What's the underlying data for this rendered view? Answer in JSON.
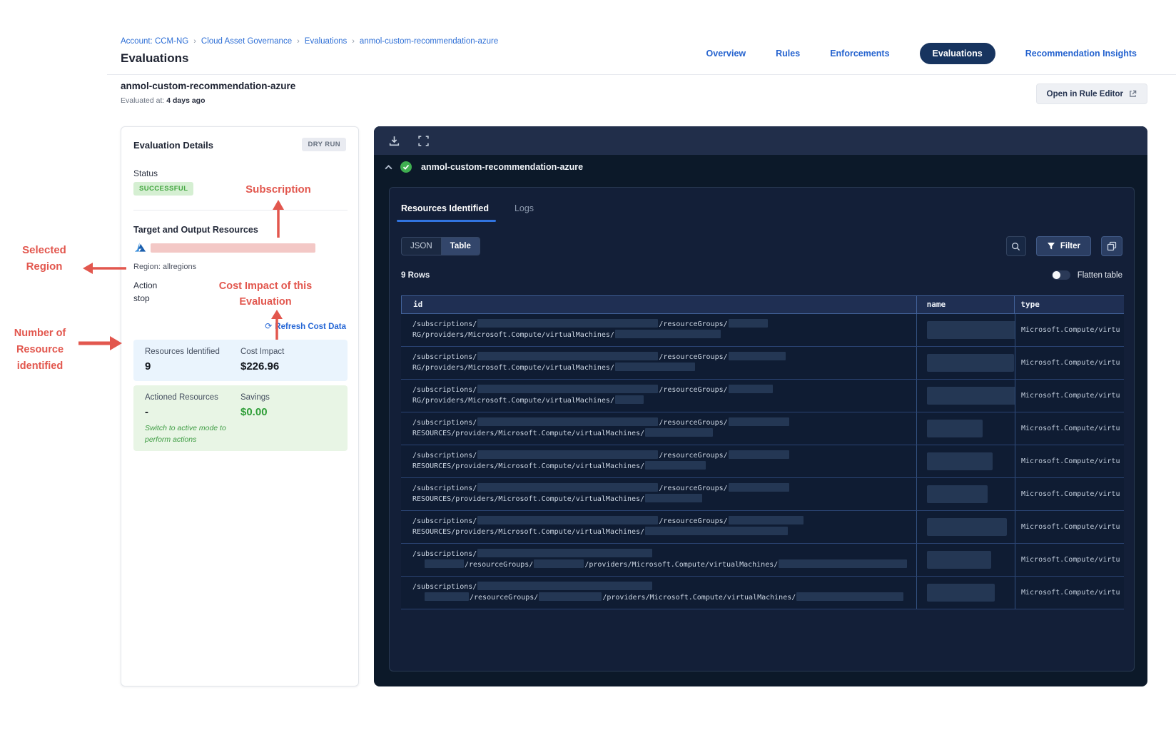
{
  "breadcrumb": {
    "separator": "›",
    "items": [
      "Account: CCM-NG",
      "Cloud Asset Governance",
      "Evaluations",
      "anmol-custom-recommendation-azure"
    ]
  },
  "page_title": "Evaluations",
  "nav": {
    "tabs": [
      "Overview",
      "Rules",
      "Enforcements",
      "Evaluations",
      "Recommendation Insights"
    ],
    "active": "Evaluations"
  },
  "header": {
    "name": "anmol-custom-recommendation-azure",
    "evaluated_label": "Evaluated at:",
    "evaluated_value": "4 days ago",
    "open_rule_editor": "Open in Rule Editor"
  },
  "details": {
    "title": "Evaluation Details",
    "mode_badge": "DRY RUN",
    "status_label": "Status",
    "status_value": "SUCCESSFUL",
    "target_title": "Target and Output Resources",
    "region_label": "Region:",
    "region_value": "allregions",
    "action_label": "Action",
    "action_value": "stop",
    "refresh_icon": "⟳",
    "refresh_link": "Refresh Cost Data",
    "resources_identified_label": "Resources Identified",
    "resources_identified_value": "9",
    "cost_impact_label": "Cost Impact",
    "cost_impact_value": "$226.96",
    "actioned_label": "Actioned Resources",
    "actioned_value": "-",
    "savings_label": "Savings",
    "savings_value": "$0.00",
    "note_line1": "Switch to active mode to",
    "note_line2": "perform actions"
  },
  "annotations": {
    "color": "#e2574e",
    "subscription": "Subscription",
    "selected_region_line1": "Selected",
    "selected_region_line2": "Region",
    "cost_impact_line1": "Cost Impact of this",
    "cost_impact_line2": "Evaluation",
    "resources_line1": "Number of",
    "resources_line2": "Resource",
    "resources_line3": "identified"
  },
  "viewer": {
    "title": "anmol-custom-recommendation-azure",
    "tabs": [
      "Resources Identified",
      "Logs"
    ],
    "active_tab": "Resources Identified",
    "view_toggle": [
      "JSON",
      "Table"
    ],
    "active_view": "Table",
    "filter_label": "Filter",
    "rows_count": "9 Rows",
    "flatten_label": "Flatten table",
    "table": {
      "columns": [
        "id",
        "name",
        "type"
      ],
      "rows": [
        {
          "line1": [
            {
              "t": "/subscriptions/"
            },
            {
              "r": 253
            },
            {
              "t": "/resourceGroups/"
            },
            {
              "r": 55
            }
          ],
          "line2": [
            {
              "t": "RG/providers/Microsoft.Compute/virtualMachines/"
            },
            {
              "r": 148
            }
          ],
          "name_r": 125,
          "type": "Microsoft.Compute/virtu"
        },
        {
          "line1": [
            {
              "t": "/subscriptions/"
            },
            {
              "r": 253
            },
            {
              "t": "/resourceGroups/"
            },
            {
              "r": 80
            }
          ],
          "line2": [
            {
              "t": "RG/providers/Microsoft.Compute/virtualMachines/"
            },
            {
              "r": 112
            }
          ],
          "name_r": 122,
          "type": "Microsoft.Compute/virtu"
        },
        {
          "line1": [
            {
              "t": "/subscriptions/"
            },
            {
              "r": 253
            },
            {
              "t": "/resourceGroups/"
            },
            {
              "r": 62
            }
          ],
          "line2": [
            {
              "t": "RG/providers/Microsoft.Compute/virtualMachines/"
            },
            {
              "r": 40
            }
          ],
          "name_r": 125,
          "type": "Microsoft.Compute/virtu"
        },
        {
          "line1": [
            {
              "t": "/subscriptions/"
            },
            {
              "r": 253
            },
            {
              "t": "/resourceGroups/"
            },
            {
              "r": 85
            }
          ],
          "line2": [
            {
              "t": "RESOURCES/providers/Microsoft.Compute/virtualMachines/"
            },
            {
              "r": 95
            }
          ],
          "name_r": 78,
          "type": "Microsoft.Compute/virtu"
        },
        {
          "line1": [
            {
              "t": "/subscriptions/"
            },
            {
              "r": 253
            },
            {
              "t": "/resourceGroups/"
            },
            {
              "r": 85
            }
          ],
          "line2": [
            {
              "t": "RESOURCES/providers/Microsoft.Compute/virtualMachines/"
            },
            {
              "r": 85
            }
          ],
          "name_r": 92,
          "type": "Microsoft.Compute/virtu"
        },
        {
          "line1": [
            {
              "t": "/subscriptions/"
            },
            {
              "r": 253
            },
            {
              "t": "/resourceGroups/"
            },
            {
              "r": 85
            }
          ],
          "line2": [
            {
              "t": "RESOURCES/providers/Microsoft.Compute/virtualMachines/"
            },
            {
              "r": 80
            }
          ],
          "name_r": 85,
          "type": "Microsoft.Compute/virtu"
        },
        {
          "line1": [
            {
              "t": "/subscriptions/"
            },
            {
              "r": 253
            },
            {
              "t": "/resourceGroups/"
            },
            {
              "r": 105
            }
          ],
          "line2": [
            {
              "t": "RESOURCES/providers/Microsoft.Compute/virtualMachines/"
            },
            {
              "r": 200
            }
          ],
          "name_r": 112,
          "type": "Microsoft.Compute/virtu"
        },
        {
          "line1": [
            {
              "t": "/subscriptions/"
            },
            {
              "r": 245
            }
          ],
          "line2": [
            {
              "sp": 16
            },
            {
              "r": 55
            },
            {
              "t": "/resourceGroups/"
            },
            {
              "r": 70
            },
            {
              "t": "/providers/Microsoft.Compute/virtualMachines/"
            },
            {
              "r": 180
            }
          ],
          "name_r": 90,
          "type": "Microsoft.Compute/virtu"
        },
        {
          "line1": [
            {
              "t": "/subscriptions/"
            },
            {
              "r": 245
            }
          ],
          "line2": [
            {
              "sp": 16
            },
            {
              "r": 62
            },
            {
              "t": "/resourceGroups/"
            },
            {
              "r": 88
            },
            {
              "t": "/providers/Microsoft.Compute/virtualMachines/"
            },
            {
              "r": 150
            }
          ],
          "name_r": 95,
          "type": "Microsoft.Compute/virtu"
        }
      ]
    }
  }
}
